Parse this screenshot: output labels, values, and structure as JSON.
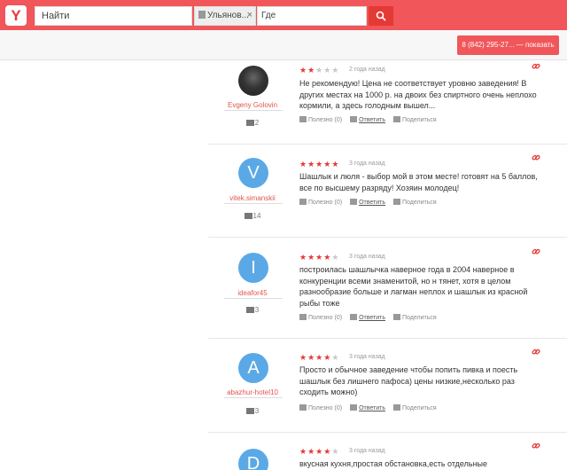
{
  "header": {
    "logo_letter": "Y",
    "search_placeholder": "Найти",
    "city": "Ульянов...",
    "city_clear": "×",
    "where_placeholder": "Где"
  },
  "phone_button": "8 (842) 295-27... — показать",
  "reviews": [
    {
      "user": "Evgeny Golovin",
      "avatar": "",
      "count": "2",
      "rating": 2,
      "date": "2 года назад",
      "text": "Не рекомендую! Цена не соответствует уровню заведения! В других местах на 1000 р. на двоих без спиртного очень неплохо кормили, а здесь голодным вышел...",
      "useful": "Полезно (0)",
      "reply": "Ответить",
      "share": "Поделиться"
    },
    {
      "user": "vitek.simanskii",
      "avatar": "V",
      "count": "14",
      "rating": 5,
      "date": "3 года назад",
      "text": "Шашлык и люля - выбор мой в этом месте! готовят на 5 баллов, все по высшему разряду! Хозяин молодец!",
      "useful": "Полезно (0)",
      "reply": "Ответить",
      "share": "Поделиться"
    },
    {
      "user": "ideafor45",
      "avatar": "I",
      "count": "3",
      "rating": 4,
      "date": "3 года назад",
      "text": "построилась шашлычка наверное года в 2004 наверное в конкуренции всеми знаменитой, но н тянет, хотя в целом разнообразие больше и лагман неплох и шашлык из красной рыбы тоже",
      "useful": "Полезно (0)",
      "reply": "Ответить",
      "share": "Поделиться"
    },
    {
      "user": "abazhur-hotel10",
      "avatar": "A",
      "count": "3",
      "rating": 4,
      "date": "3 года назад",
      "text": "Просто и обычное заведение чтобы попить пивка и поесть шашлык без лишнего пафоса) цены низкие,несколько раз сходить можно)",
      "useful": "Полезно (0)",
      "reply": "Ответить",
      "share": "Поделиться"
    },
    {
      "user": "",
      "avatar": "D",
      "count": "",
      "rating": 4,
      "date": "3 года назад",
      "text": "вкусная кухня,простая обстановка,есть отдельные",
      "useful": "",
      "reply": "",
      "share": ""
    }
  ]
}
